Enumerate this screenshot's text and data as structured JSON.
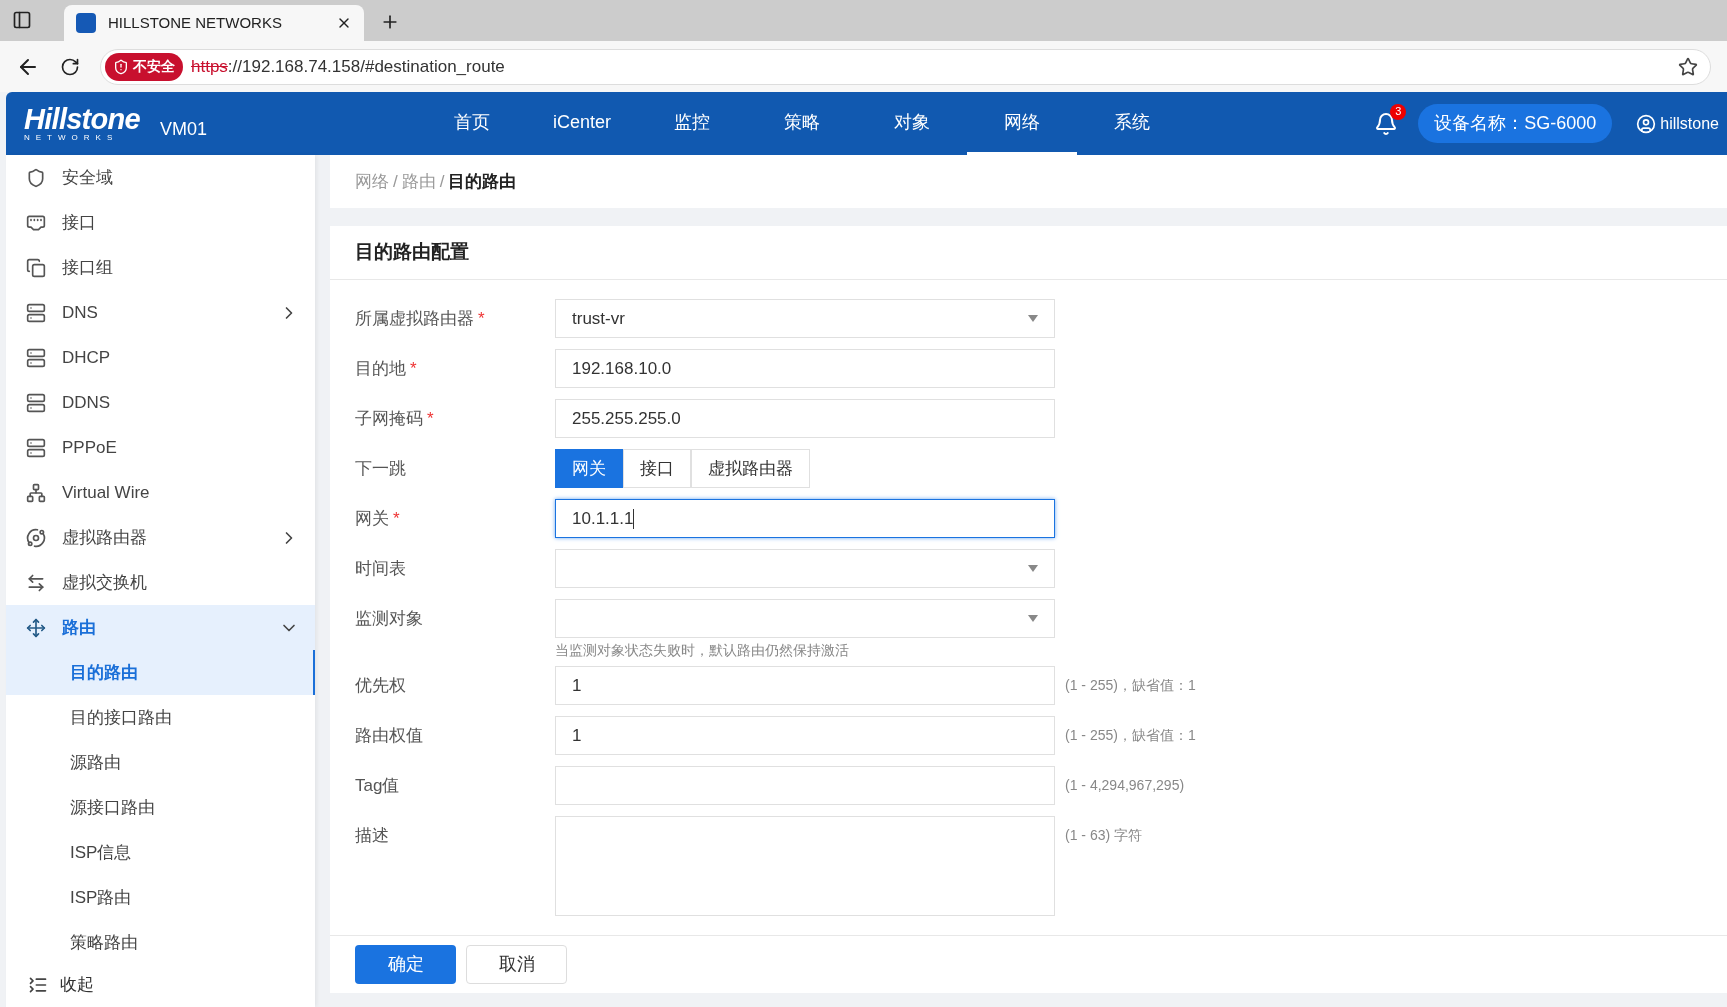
{
  "browser": {
    "tab_title": "HILLSTONE NETWORKS",
    "security_badge": "不安全",
    "url_scheme": "https",
    "url_rest": "://192.168.74.158/#destination_route"
  },
  "header": {
    "logo_main": "Hillstone",
    "logo_sub": "NETWORKS",
    "device": "VM01",
    "nav": [
      {
        "label": "首页",
        "selected": false
      },
      {
        "label": "iCenter",
        "selected": false
      },
      {
        "label": "监控",
        "selected": false
      },
      {
        "label": "策略",
        "selected": false
      },
      {
        "label": "对象",
        "selected": false
      },
      {
        "label": "网络",
        "selected": true
      },
      {
        "label": "系统",
        "selected": false
      }
    ],
    "notification_count": "3",
    "device_name": "设备名称：SG-6000",
    "user": "hillstone"
  },
  "sidebar": {
    "items": [
      {
        "label": "安全域",
        "selected": false
      },
      {
        "label": "接口",
        "selected": false
      },
      {
        "label": "接口组",
        "selected": false
      },
      {
        "label": "DNS",
        "selected": false,
        "expanded": false
      },
      {
        "label": "DHCP",
        "selected": false
      },
      {
        "label": "DDNS",
        "selected": false
      },
      {
        "label": "PPPoE",
        "selected": false
      },
      {
        "label": "Virtual Wire",
        "selected": false
      },
      {
        "label": "虚拟路由器",
        "selected": false,
        "expanded": false
      },
      {
        "label": "虚拟交换机",
        "selected": false
      },
      {
        "label": "路由",
        "selected": true,
        "expanded": true,
        "children": [
          {
            "label": "目的路由",
            "selected": true
          },
          {
            "label": "目的接口路由",
            "selected": false
          },
          {
            "label": "源路由",
            "selected": false
          },
          {
            "label": "源接口路由",
            "selected": false
          },
          {
            "label": "ISP信息",
            "selected": false
          },
          {
            "label": "ISP路由",
            "selected": false
          },
          {
            "label": "策略路由",
            "selected": false
          }
        ]
      }
    ],
    "collapse": "收起"
  },
  "breadcrumb": [
    {
      "kind": "link",
      "text": "网络"
    },
    {
      "kind": "separator",
      "text": "/"
    },
    {
      "kind": "link",
      "text": "路由"
    },
    {
      "kind": "separator",
      "text": "/"
    },
    {
      "kind": "current",
      "text": "目的路由"
    }
  ],
  "form": {
    "title": "目的路由配置",
    "fields": [
      {
        "kind": "select",
        "label": "所属虚拟路由器",
        "required_mark": "*",
        "value": "trust-vr"
      },
      {
        "kind": "text",
        "label": "目的地",
        "required_mark": "*",
        "value": "192.168.10.0"
      },
      {
        "kind": "text",
        "label": "子网掩码",
        "required_mark": "*",
        "value": "255.255.255.0"
      },
      {
        "kind": "segmented",
        "label": "下一跳",
        "options": [
          {
            "label": "网关",
            "selected": true
          },
          {
            "label": "接口",
            "selected": false
          },
          {
            "label": "虚拟路由器",
            "selected": false
          }
        ]
      },
      {
        "kind": "text",
        "label": "网关",
        "required_mark": "*",
        "value": "10.1.1.1",
        "focused": true
      },
      {
        "kind": "select",
        "label": "时间表"
      },
      {
        "kind": "select",
        "label": "监测对象",
        "note": "当监测对象状态失败时，默认路由仍然保持激活"
      },
      {
        "kind": "text",
        "label": "优先权",
        "value": "1",
        "hint": "(1 - 255)，缺省值：1"
      },
      {
        "kind": "text",
        "label": "路由权值",
        "value": "1",
        "hint": "(1 - 255)，缺省值：1"
      },
      {
        "kind": "text",
        "label": "Tag值",
        "hint": "(1 - 4,294,967,295)"
      },
      {
        "kind": "textarea",
        "label": "描述",
        "hint": "(1 - 63) 字符"
      }
    ],
    "buttons": [
      {
        "label": "确定",
        "kind": "primary"
      },
      {
        "label": "取消",
        "kind": "secondary"
      }
    ]
  }
}
